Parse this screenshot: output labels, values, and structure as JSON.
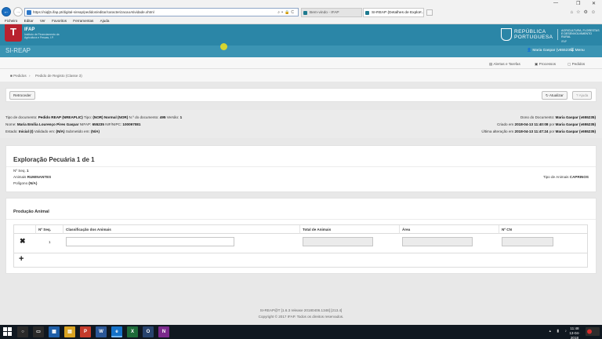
{
  "browser": {
    "url": "https://siqlj5.ifap.pt/digital-sireap/pedidos/editar/caracterizacaoAtividade.xhtml",
    "tabs": [
      {
        "label": "Bem-vindo - IFAP"
      },
      {
        "label": "SI-REAP (Detalhes de Explor..."
      }
    ],
    "menu": [
      "Ficheiro",
      "Editar",
      "Ver",
      "Favoritos",
      "Ferramentas",
      "Ajuda"
    ]
  },
  "header": {
    "logo_letter": "T",
    "brand": "IFAP",
    "brand_sub": "Instituto de Financiamento da Agricultura e Pescas, I.P.",
    "republica": [
      "REPÚBLICA",
      "PORTUGUESA"
    ],
    "ministry": "AGRICULTURA, FLORESTAS E DESENVOLVIMENTO RURAL",
    "ministry_sub": "IFAP"
  },
  "appbar": {
    "app_name": "SI-REAP",
    "user": "Maria Gaspar (v655235)",
    "menu": "Menu"
  },
  "toolbar": {
    "alerts": "Alertas e Tarefas",
    "processes": "Processos",
    "requests": "Pedidos"
  },
  "breadcrumb": {
    "root": "Pedidos",
    "current": "Pedido de Registo (Classe 3)"
  },
  "actions": {
    "back": "Retroceder",
    "refresh": "Atualizar",
    "help": "Ajuda"
  },
  "info": {
    "line1_l": "Tipo de documento:",
    "doc_type": "Pedido REAP (NREAPLIC)",
    "line1_tipo": "Tipo:",
    "tipo": "(NOR) Normal (NOR)",
    "line1_num": "N.º do documento:",
    "num": "495",
    "line1_ver": "Versão:",
    "ver": "1",
    "line2_l": "Nome:",
    "nome": "Maria Emília Lourenço Pires Gaspar",
    "line2_nifap_l": "NIFAP:",
    "nifap": "655235",
    "line2_nif_l": "NIF/NIPC:",
    "nif": "100097081",
    "line3_l": "Estado:",
    "estado": "Inicial (I)",
    "line3_val_l": "Validado em:",
    "validado": "(N/A)",
    "line3_sub_l": "Submetido em:",
    "submetido": "(N/A)",
    "dono_l": "Dono do Documento:",
    "dono": "Maria Gaspar (v655235)",
    "criado_l": "Criado em",
    "criado": "2018-04-13 11:40:08",
    "criado_por_l": "por",
    "criado_por": "Maria Gaspar (v655235)",
    "alt_l": "Última alteração em",
    "alt": "2018-04-13 11:47:24",
    "alt_por_l": "por",
    "alt_por": "Maria Gaspar (v655235)"
  },
  "exploracao": {
    "title": "Exploração Pecuária 1 de 1",
    "seq_l": "Nº Seq.",
    "seq": "1",
    "animais_l": "Animais",
    "animais": "RUMINANTES",
    "poligono_l": "Polígono",
    "poligono": "(N/A)",
    "tipo_l": "Tipo de Animais",
    "tipo": "CAPRINOS"
  },
  "producao": {
    "title": "Produção Animal",
    "columns": [
      "Nº Seq.",
      "Classificação dos Animais",
      "Total de Animais",
      "Área",
      "Nº CN"
    ],
    "row_seq": "1"
  },
  "footer": {
    "line1": "SI-REAP@T [1.6.3 release 20180406.1348] [213.4]",
    "line2": "Copyright © 2017 IFAP. Todos os direitos reservados."
  },
  "taskbar": {
    "time": "11:48",
    "date": "13-04-2018"
  }
}
